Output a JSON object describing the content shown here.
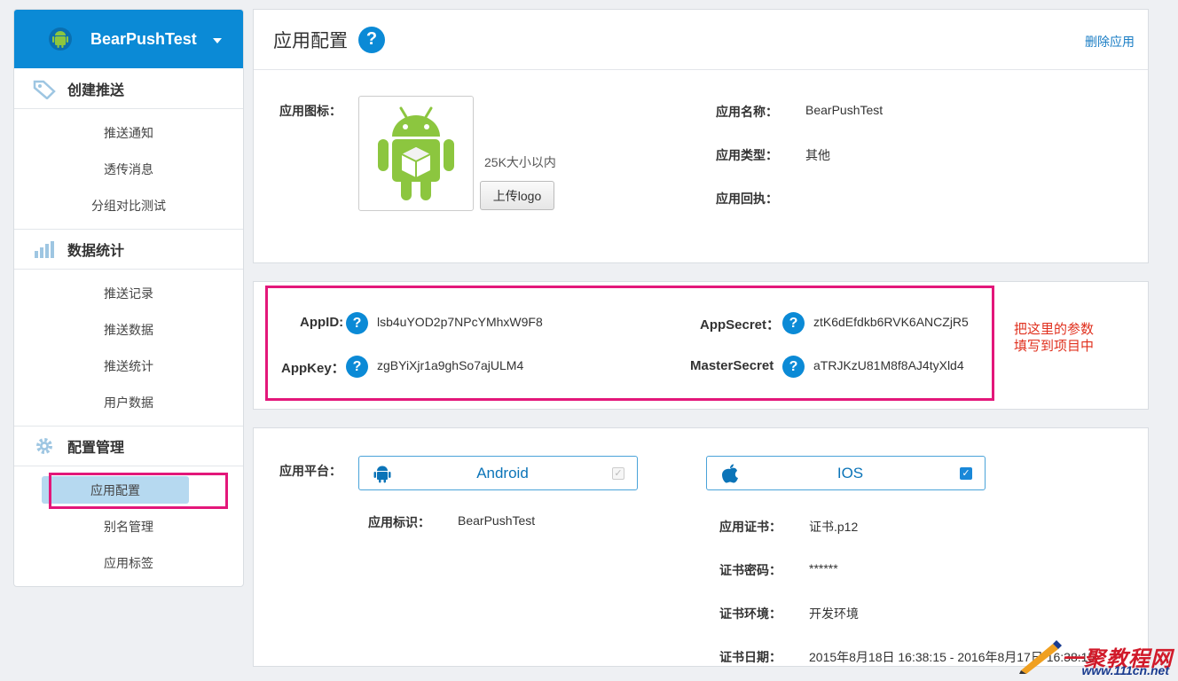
{
  "sidebar": {
    "app_name": "BearPushTest",
    "sections": [
      {
        "label": "创建推送",
        "items": [
          "推送通知",
          "透传消息",
          "分组对比测试"
        ]
      },
      {
        "label": "数据统计",
        "items": [
          "推送记录",
          "推送数据",
          "推送统计",
          "用户数据"
        ]
      },
      {
        "label": "配置管理",
        "items": [
          "应用配置",
          "别名管理",
          "应用标签"
        ]
      }
    ]
  },
  "page": {
    "title": "应用配置",
    "help": "?",
    "delete_link": "删除应用"
  },
  "app_info": {
    "icon_label": "应用图标：",
    "size_hint": "25K大小以内",
    "upload_label": "上传logo",
    "name_label": "应用名称：",
    "name_value": "BearPushTest",
    "type_label": "应用类型：",
    "type_value": "其他",
    "receipt_label": "应用回执："
  },
  "keys": {
    "appid_label": "AppID:",
    "appid_value": "lsb4uYOD2p7NPcYMhxW9F8",
    "appkey_label": "AppKey：",
    "appkey_value": "zgBYiXjr1a9ghSo7ajULM4",
    "appsecret_label": "AppSecret：",
    "appsecret_value": "ztK6dEfdkb6RVK6ANCZjR5",
    "mastersecret_label": "MasterSecret",
    "mastersecret_value": "aTRJKzU81M8f8AJ4tyXld4",
    "note_line1": "把这里的参数",
    "note_line2": "填写到项目中"
  },
  "platform": {
    "label": "应用平台：",
    "android_name": "Android",
    "android_checked": false,
    "ios_name": "IOS",
    "ios_checked": true,
    "android_id_label": "应用标识：",
    "android_id_value": "BearPushTest",
    "cert_label": "应用证书：",
    "cert_value": "证书.p12",
    "cert_pwd_label": "证书密码：",
    "cert_pwd_value": "******",
    "cert_env_label": "证书环境：",
    "cert_env_value": "开发环境",
    "cert_date_label": "证书日期：",
    "cert_date_value": "2015年8月18日 16:38:15  - 2016年8月17日 16:38:15"
  },
  "watermark": {
    "line1": "一聚教程网",
    "line2": "www.111cn.net"
  },
  "colors": {
    "brand_blue": "#0b8ad6",
    "highlight_pink": "#e3177a",
    "note_red": "#e0301e",
    "android_green": "#8cc63f"
  }
}
